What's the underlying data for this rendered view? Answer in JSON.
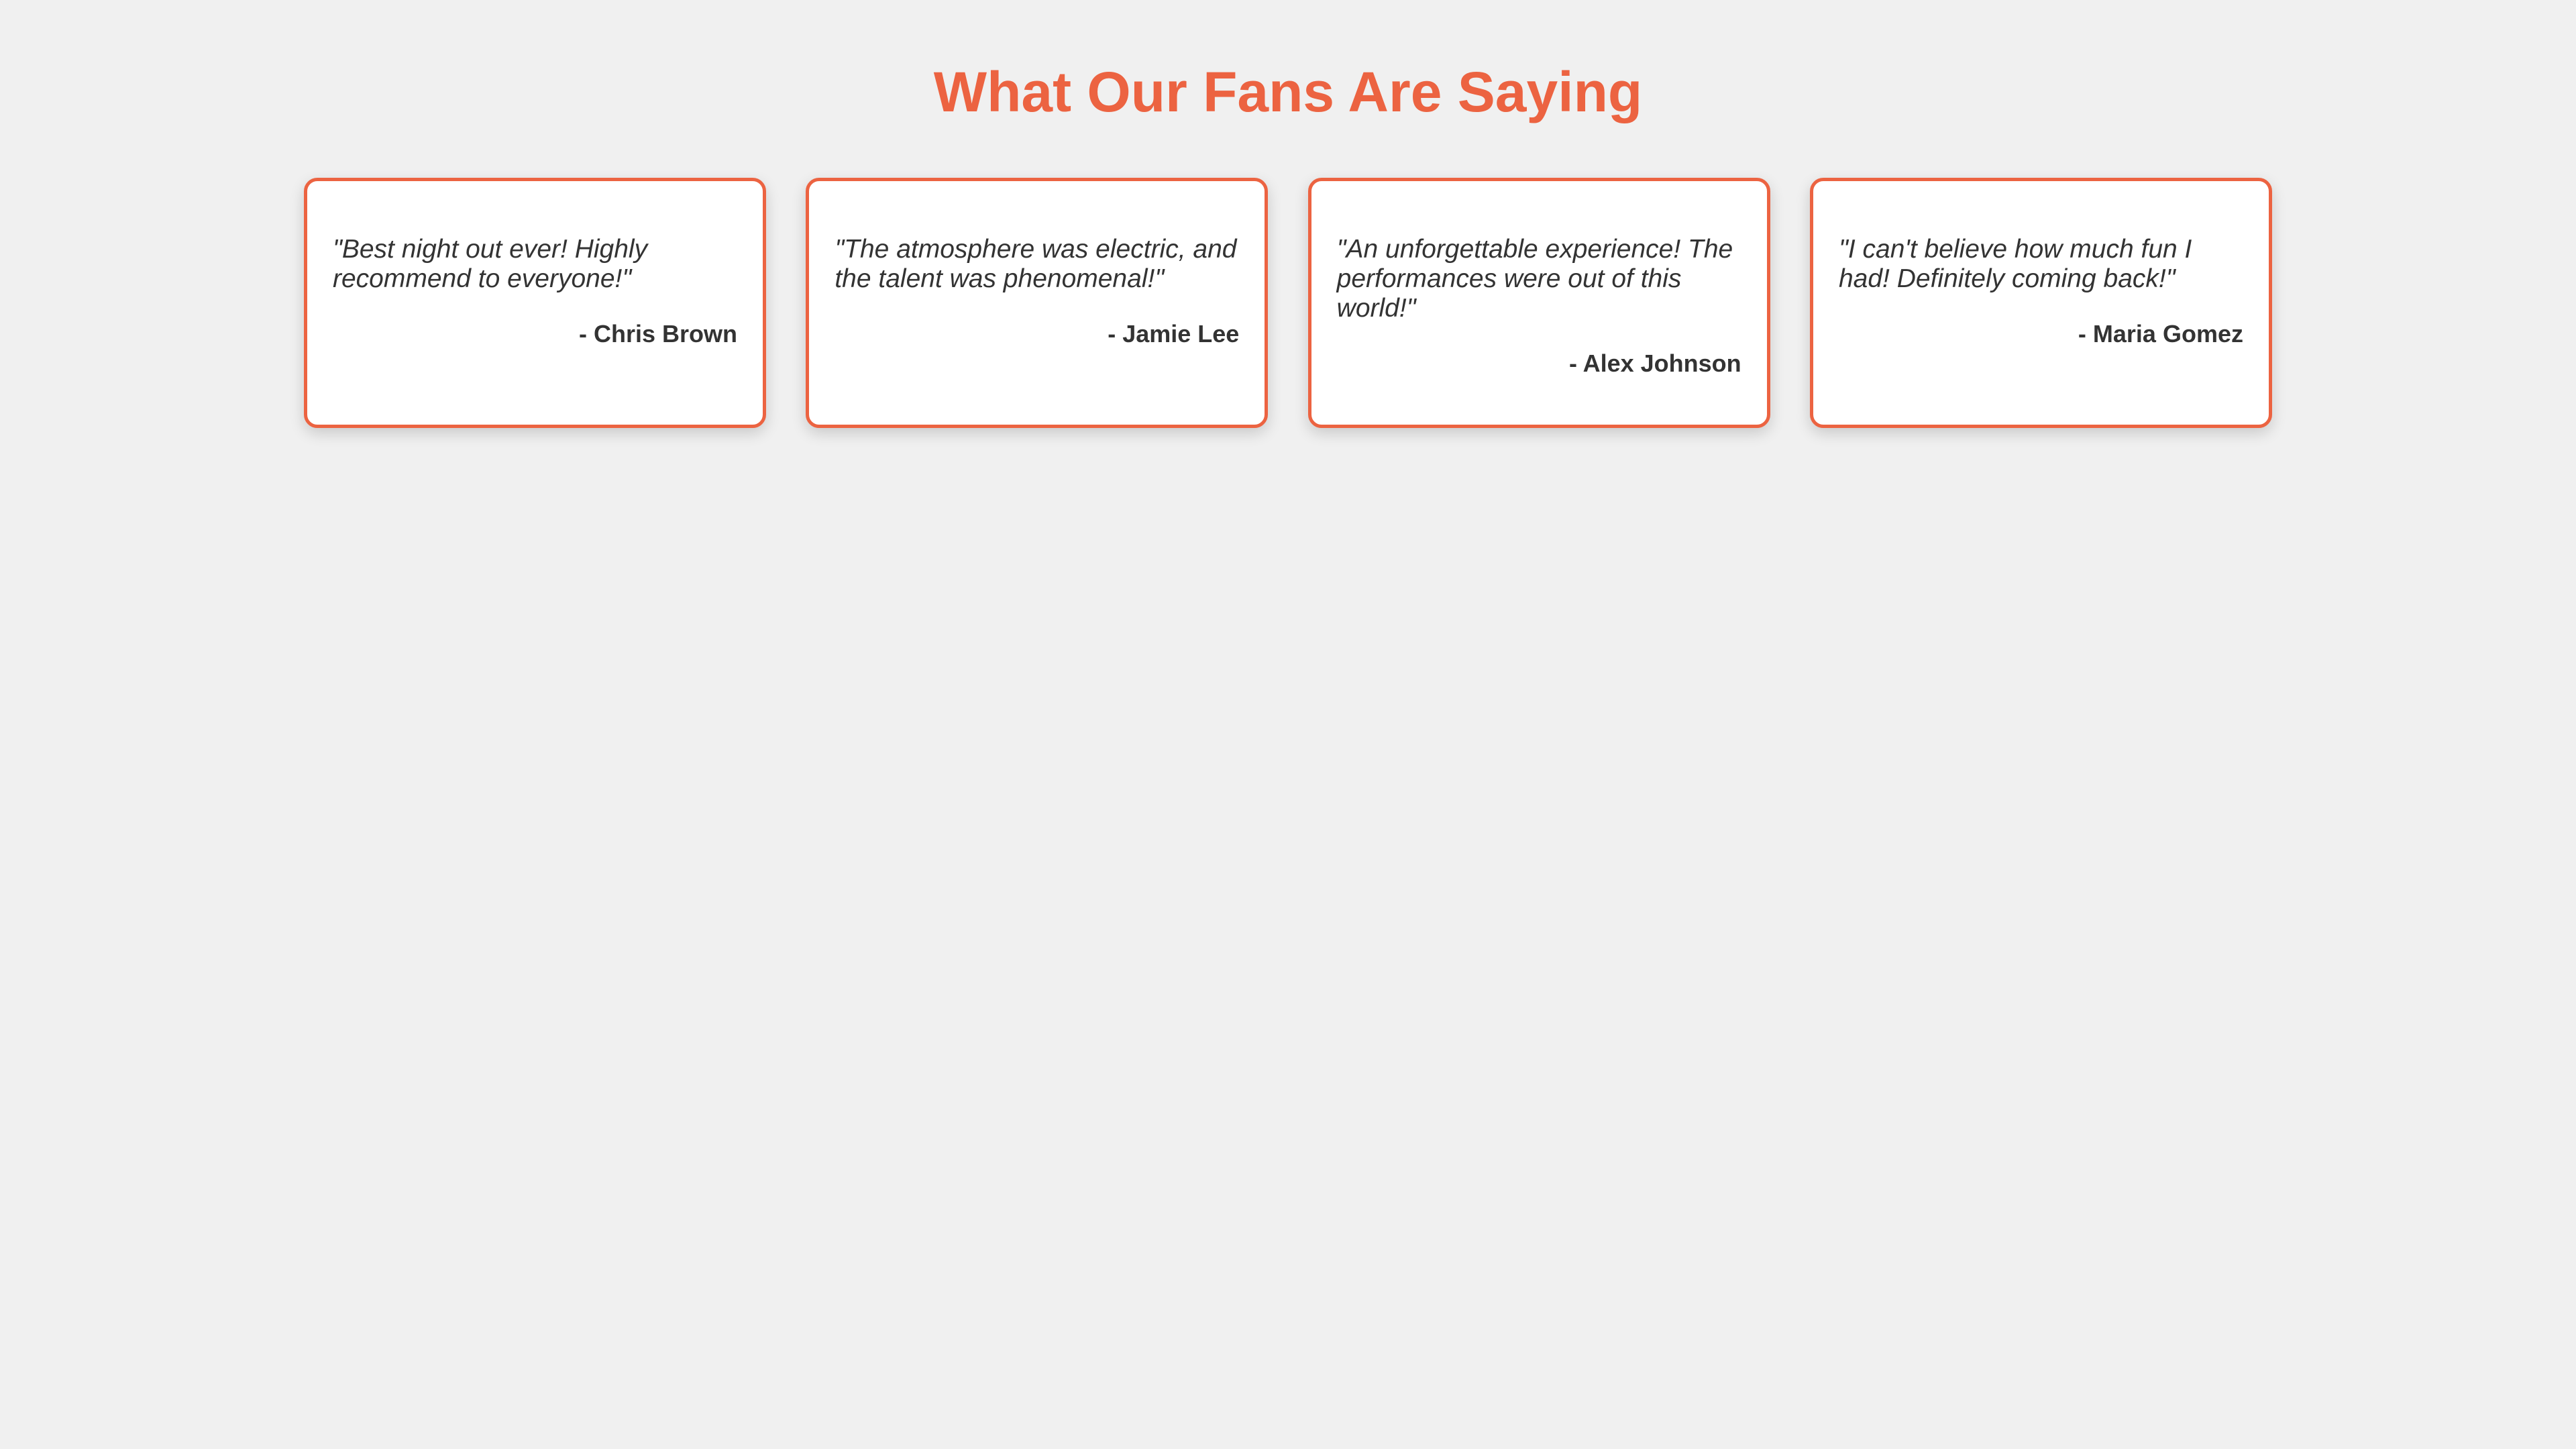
{
  "header": {
    "title": "What Our Fans Are Saying"
  },
  "testimonials": [
    {
      "quote": "\"Best night out ever! Highly recommend to everyone!\"",
      "author": "- Chris Brown"
    },
    {
      "quote": "\"The atmosphere was electric, and the talent was phenomenal!\"",
      "author": "- Jamie Lee"
    },
    {
      "quote": "\"An unforgettable experience! The performances were out of this world!\"",
      "author": "- Alex Johnson"
    },
    {
      "quote": "\"I can't believe how much fun I had! Definitely coming back!\"",
      "author": "- Maria Gomez"
    }
  ],
  "colors": {
    "accent": "#ec6341",
    "background": "#f0f0f0",
    "card": "#ffffff",
    "text": "#333333"
  }
}
